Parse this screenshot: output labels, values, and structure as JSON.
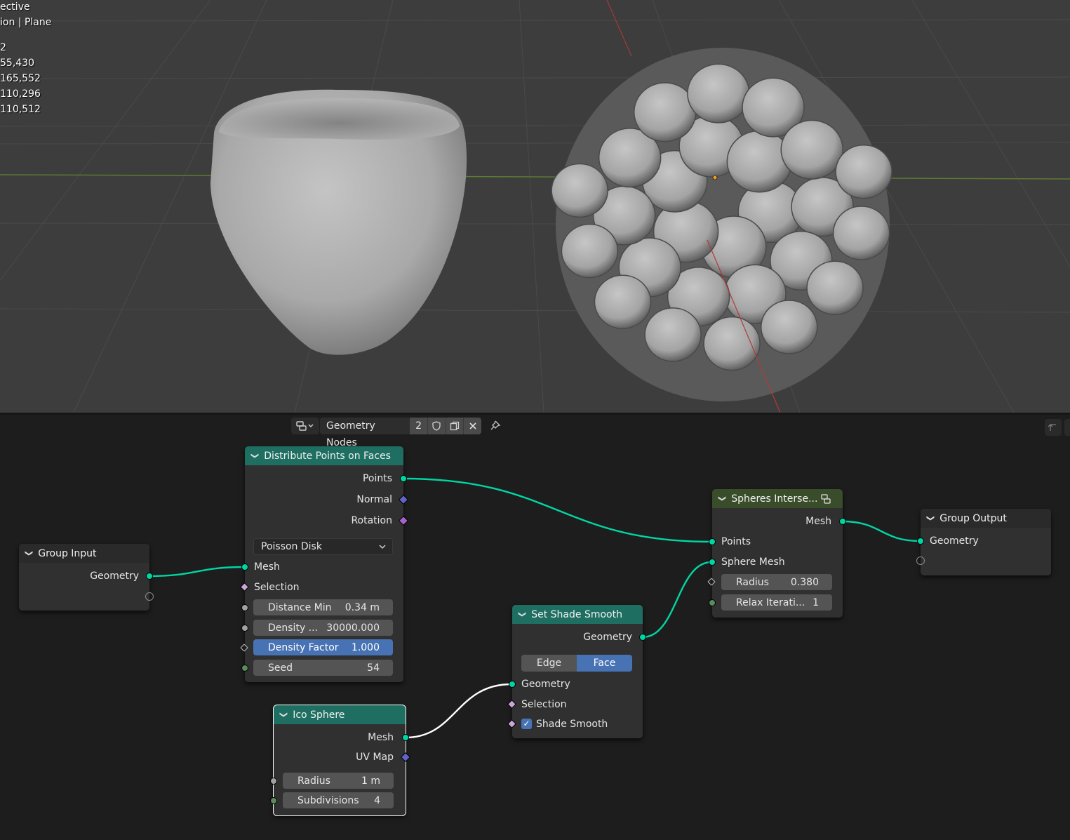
{
  "viewport": {
    "overlay_lines": [
      "ective",
      "ion | Plane"
    ],
    "stats": [
      "2",
      "55,430",
      "165,552",
      "110,296",
      "110,512"
    ]
  },
  "header": {
    "editor_type_icon": "node-editor-icon",
    "tree_name": "Geometry Nodes",
    "user_count": "2",
    "fake_user_icon": "shield-icon",
    "duplicate_icon": "copy-icon",
    "close_icon": "close-icon",
    "pin_icon": "pin-icon",
    "parent_icon": "arrow-up-icon"
  },
  "nodes": {
    "group_input": {
      "title": "Group Input",
      "outputs": [
        "Geometry"
      ]
    },
    "distribute": {
      "title": "Distribute Points on Faces",
      "outputs": [
        "Points",
        "Normal",
        "Rotation"
      ],
      "mode": "Poisson Disk",
      "inputs": [
        "Mesh",
        "Selection"
      ],
      "fields": [
        {
          "label": "Distance Min",
          "value": "0.34 m"
        },
        {
          "label": "Density ...",
          "value": "30000.000"
        },
        {
          "label": "Density Factor",
          "value": "1.000"
        },
        {
          "label": "Seed",
          "value": "54"
        }
      ]
    },
    "ico_sphere": {
      "title": "Ico Sphere",
      "outputs": [
        "Mesh",
        "UV Map"
      ],
      "fields": [
        {
          "label": "Radius",
          "value": "1 m"
        },
        {
          "label": "Subdivisions",
          "value": "4"
        }
      ]
    },
    "shade_smooth": {
      "title": "Set Shade Smooth",
      "outputs": [
        "Geometry"
      ],
      "domain_options": [
        "Edge",
        "Face"
      ],
      "domain_selected": "Face",
      "inputs": [
        "Geometry",
        "Selection",
        "Shade Smooth"
      ],
      "shade_smooth_checked": true
    },
    "spheres": {
      "title": "Spheres Interse...",
      "outputs": [
        "Mesh"
      ],
      "inputs": [
        "Points",
        "Sphere Mesh"
      ],
      "fields": [
        {
          "label": "Radius",
          "value": "0.380"
        },
        {
          "label": "Relax Iterati...",
          "value": "1"
        }
      ]
    },
    "group_output": {
      "title": "Group Output",
      "inputs": [
        "Geometry"
      ]
    }
  },
  "colors": {
    "geometry_socket": "#00d6a3",
    "geo_node_header": "#1e6f62",
    "group_node_header": "#3a4d2a",
    "active_field": "#4772b3"
  }
}
